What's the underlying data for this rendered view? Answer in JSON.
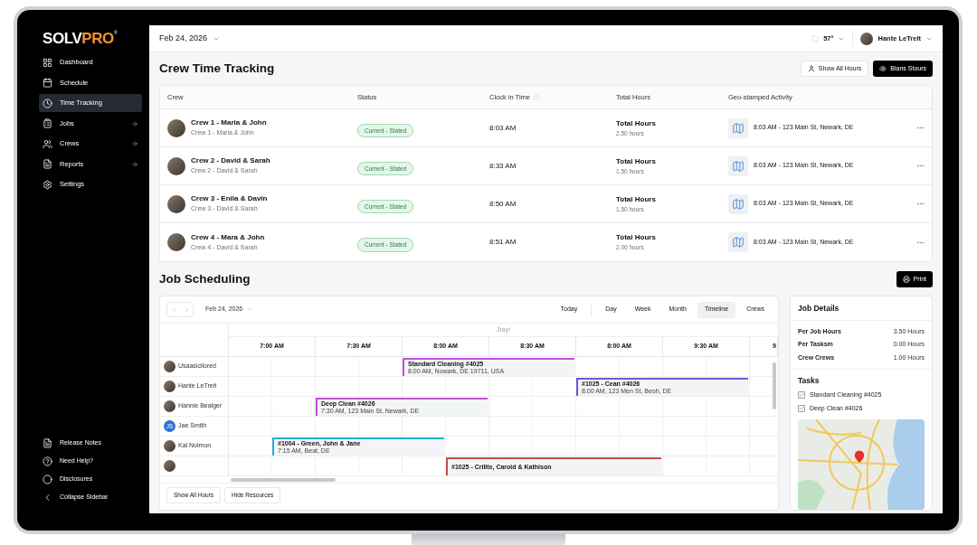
{
  "header": {
    "date": "Feb 24, 2026",
    "temperature": "57°",
    "user": "Hante LeTrelt"
  },
  "sidebar": {
    "logo": {
      "part_1": "SOLV",
      "part_2": "PRO",
      "mark": "®"
    },
    "items": [
      {
        "label": "Dashboard",
        "kind": "grid",
        "selected": false,
        "has_arrow": false
      },
      {
        "label": "Schedule",
        "kind": "calendar",
        "selected": false,
        "has_arrow": false
      },
      {
        "label": "Time Tracking",
        "kind": "clock",
        "selected": true,
        "has_arrow": false
      },
      {
        "label": "Jobs",
        "kind": "clipboard",
        "selected": false,
        "has_arrow": true
      },
      {
        "label": "Crews",
        "kind": "people",
        "selected": false,
        "has_arrow": true
      },
      {
        "label": "Reports",
        "kind": "document",
        "selected": false,
        "has_arrow": true
      },
      {
        "label": "Settings",
        "kind": "gear",
        "selected": false,
        "has_arrow": false
      }
    ],
    "footer_items": [
      {
        "label": "Release Notes",
        "kind": "document"
      },
      {
        "label": "Need Help?",
        "kind": "help"
      },
      {
        "label": "Disclosures",
        "kind": "circle"
      },
      {
        "label": "Collapse Sidebar",
        "kind": "chevron"
      }
    ]
  },
  "crew_time_tracking": {
    "title": "Crew Time Tracking",
    "buttons": [
      {
        "label": "Show All Hours",
        "kind": "outline"
      },
      {
        "label": "Blans Stours",
        "kind": "dark"
      }
    ],
    "table": {
      "columns": [
        "Crew",
        "Status",
        "Clock in Time",
        "Total Hours",
        "Geo-stamped Activity"
      ],
      "rows": [
        {
          "name": "Crew 1 - Maria & John",
          "subtitle": "Crew 1 - Maria & John",
          "status": "Current - Stated",
          "clock_in": "8:03 AM",
          "hours_label": "Total Hours",
          "hours": "2.50 hours",
          "activity": "8:03 AM - 123 Main St, Newark, DE"
        },
        {
          "name": "Crew 2 - David & Sarah",
          "subtitle": "Crew 2 - David & Sarah",
          "status": "Current - Stated",
          "clock_in": "8:33 AM",
          "hours_label": "Total Hours",
          "hours": "1.50 hours",
          "activity": "8:03 AM - 123 Main St, Newark, DE"
        },
        {
          "name": "Crew 3 - Enila & Davin",
          "subtitle": "Crew 3 - David & Sarah",
          "status": "Current - Stated",
          "clock_in": "8:50 AM",
          "hours_label": "Total Hours",
          "hours": "1.50 hours",
          "activity": "8:03 AM - 123 Main St, Newark, DE"
        },
        {
          "name": "Crew 4 - Mara & John",
          "subtitle": "Crew 4 - David & Sarah",
          "status": "Current - Stated",
          "clock_in": "8:51 AM",
          "hours_label": "Total Hours",
          "hours": "2.00 hours",
          "activity": "8:03 AM - 123 Main St, Newark, DE"
        }
      ]
    }
  },
  "job_scheduling": {
    "title": "Job Scheduling",
    "print_button": "Print",
    "calendar": {
      "date": "Feb 24, 2026",
      "views": [
        {
          "label": "Today",
          "selected": false
        },
        {
          "label": "Day",
          "selected": false
        },
        {
          "label": "Week",
          "selected": false
        },
        {
          "label": "Month",
          "selected": false
        },
        {
          "label": "Timeline",
          "selected": true
        },
        {
          "label": "Crews",
          "selected": false
        }
      ],
      "header_label": "Jray!",
      "times": [
        "7:00 AM",
        "7:30 AM",
        "8:00 AM",
        "8:30 AM",
        "8:00 AM",
        "9:30 AM",
        "9"
      ],
      "resources": [
        {
          "name": "Usaasicilored",
          "events": [
            {
              "title": "Standard Cleaning #4025",
              "detail": "8:00 AM, Nowark, DE 19711, USA",
              "color": "#c24fd6"
            }
          ]
        },
        {
          "name": "Hante LeTreit",
          "events": [
            {
              "title": "#1025 - Cean #4026",
              "detail": "8:00 AM, 123 Men St, Beoh, DE",
              "color": "#6a5ad6"
            }
          ]
        },
        {
          "name": "Hannie Bealger",
          "events": [
            {
              "title": "Deep Clean #4026",
              "detail": "7:30 AM, 123 Main St, Newark, DE",
              "color": "#c24fd6"
            }
          ]
        },
        {
          "name": "Jae Smith",
          "initials": "JS"
        },
        {
          "name": "Kal Nolmon",
          "events": [
            {
              "title": "#1004 - Green, John & Jane",
              "detail": "7:15 AM, Beat, DE",
              "color": "#1fb3cc"
            }
          ]
        },
        {
          "events": [
            {
              "title": "#1025 - Crillte, Caroid & Kathison",
              "color": "#c0504d"
            }
          ]
        }
      ],
      "buttons": [
        "Show All Hours",
        "Hide Resources"
      ]
    },
    "job_details": {
      "title": "Job Details",
      "stats": [
        {
          "label": "Per Job Hours",
          "value": "3.50 Hours"
        },
        {
          "label": "Per Tasksm",
          "value": "0.00 Hours"
        },
        {
          "label": "Crew Crews",
          "value": "1.00 Hours"
        }
      ],
      "tasks_title": "Tasks",
      "tasks": [
        {
          "label": "Standard Cleaning #4025",
          "checked": true
        },
        {
          "label": "Deep Clean #4026",
          "checked": true
        }
      ]
    }
  }
}
